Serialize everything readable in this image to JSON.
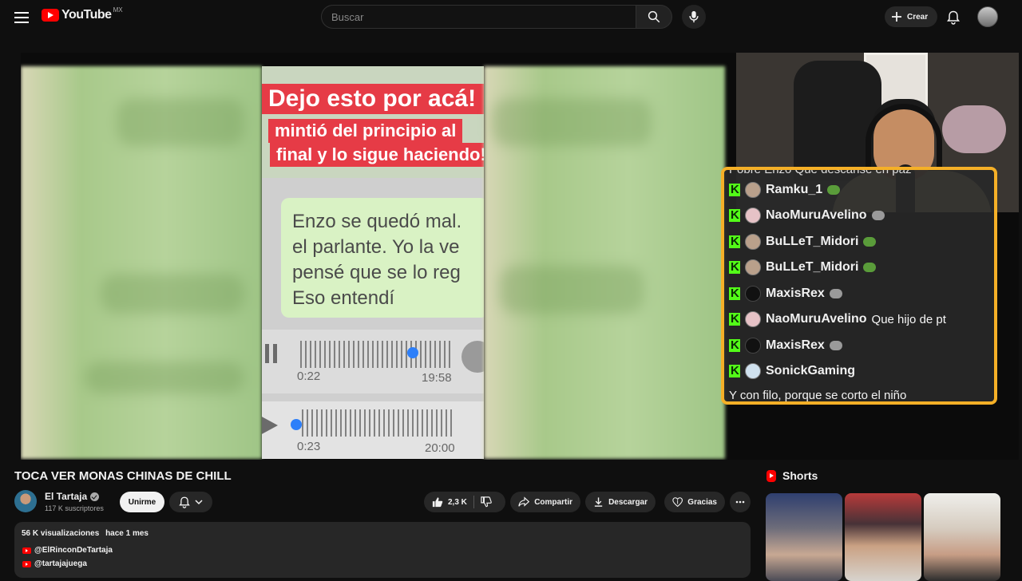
{
  "header": {
    "logo_text": "YouTube",
    "country": "MX",
    "search_placeholder": "Buscar",
    "create_label": "Crear"
  },
  "video_overlay": {
    "caption_line1": "Dejo esto por acá!",
    "caption_line2": "mintió del principio al",
    "caption_line3": "final y lo sigue haciendo!",
    "message_lines": [
      "Enzo se quedó mal.",
      "el parlante. Yo la ve",
      "pensé que se lo reg",
      "Eso entendí"
    ],
    "audio1": {
      "position": "0:22",
      "time": "19:58"
    },
    "audio2": {
      "position": "0:23",
      "time": "20:00"
    }
  },
  "chat": {
    "cut_line": "Pobre Enzo Que descanse en paz",
    "messages": [
      {
        "user": "Ramku_1",
        "text": ""
      },
      {
        "user": "NaoMuruAvelino",
        "text": ""
      },
      {
        "user": "BuLLeT_Midori",
        "text": ""
      },
      {
        "user": "BuLLeT_Midori",
        "text": ""
      },
      {
        "user": "MaxisRex",
        "text": ""
      },
      {
        "user": "NaoMuruAvelino",
        "text": "Que hijo de pt"
      },
      {
        "user": "MaxisRex",
        "text": ""
      },
      {
        "user": "SonickGaming",
        "text": ""
      }
    ],
    "last_line": "Y con filo, porque se corto el niño",
    "border_color": "#f5b027",
    "kick_color": "#53fc18"
  },
  "video": {
    "title": "TOCA VER MONAS CHINAS DE CHILL",
    "channel": "El Tartaja",
    "subscribers": "117 K suscriptores",
    "join_label": "Unirme",
    "likes": "2,3 K",
    "share_label": "Compartir",
    "download_label": "Descargar",
    "thanks_label": "Gracias"
  },
  "description": {
    "views": "56 K visualizaciones",
    "date": "hace 1 mes",
    "links": [
      "@ElRinconDeTartaja",
      "@tartajajuega"
    ]
  },
  "shorts": {
    "heading": "Shorts"
  }
}
